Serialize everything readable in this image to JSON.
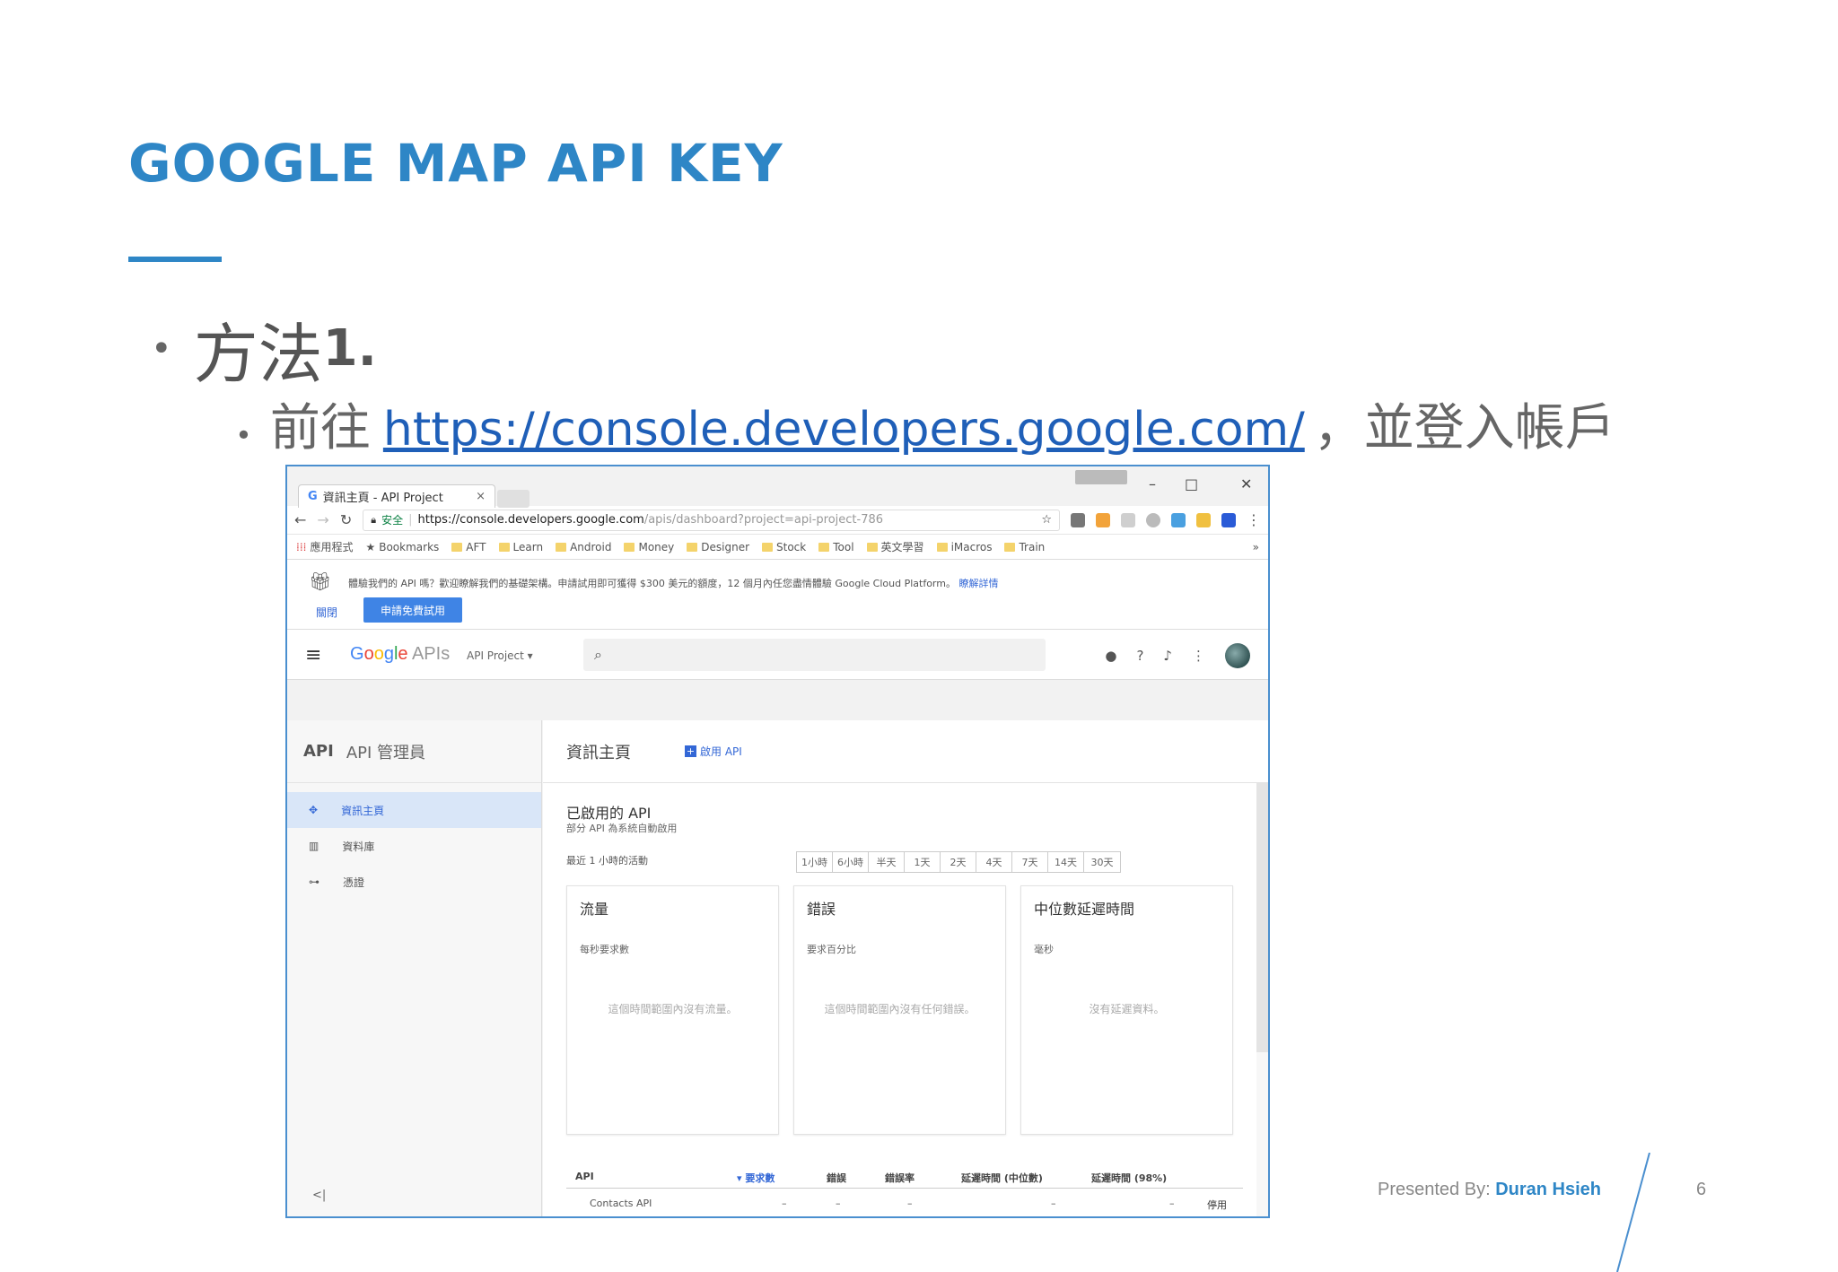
{
  "slide": {
    "title": "GOOGLE MAP API KEY",
    "bullet1_text": "方法",
    "bullet1_num": "1.",
    "bullet2_prefix": "前往",
    "bullet2_link": "https://console.developers.google.com/",
    "bullet2_suffix": "，並登入帳戶",
    "presented_by_label": "Presented By: ",
    "presenter": "Duran Hsieh",
    "page_number": "6"
  },
  "browser": {
    "tab_title": "資訊主頁 - API Project",
    "tab_favicon": "G",
    "tab_close": "×",
    "window_controls": [
      "–",
      "□",
      "✕"
    ],
    "secure_label": "安全",
    "url_main": "https://console.developers.google.com",
    "url_rest": "/apis/dashboard?project=api-project-786",
    "bookmarks": [
      "應用程式",
      "Bookmarks",
      "AFT",
      "Learn",
      "Android",
      "Money",
      "Designer",
      "Stock",
      "Tool",
      "英文學習",
      "iMacros",
      "Train"
    ],
    "bookmarks_more": "»",
    "extension_colors": [
      "#777777",
      "#f2a33a",
      "#cfcfcf",
      "#bbbbbb",
      "#4aa0e0",
      "#f0c040",
      "#2a5bd7"
    ]
  },
  "promo": {
    "text": "體驗我們的 API 嗎？歡迎瞭解我們的基礎架構。申請試用即可獲得 $300 美元的額度，12 個月內任您盡情體驗 Google Cloud Platform。",
    "learn_more": "瞭解詳情",
    "dismiss": "關閉",
    "try_button": "申請免費試用"
  },
  "appbar": {
    "logo_letters": [
      "G",
      "o",
      "o",
      "g",
      "l",
      "e"
    ],
    "logo_suffix": " APIs",
    "project": "API Project ▾",
    "search_icon": "⌕"
  },
  "sidebar": {
    "api_label": "API",
    "title": "API 管理員",
    "items": [
      {
        "icon": "✥",
        "label": "資訊主頁"
      },
      {
        "icon": "▥",
        "label": "資料庫"
      },
      {
        "icon": "⊶",
        "label": "憑證"
      }
    ],
    "collapse": "<|"
  },
  "main": {
    "title": "資訊主頁",
    "enable_api": "啟用 API",
    "section_title": "已啟用的 API",
    "section_subtitle": "部分 API 為系統自動啟用",
    "recent_label": "最近 1 小時的活動",
    "time_ranges": [
      "1小時",
      "6小時",
      "半天",
      "1天",
      "2天",
      "4天",
      "7天",
      "14天",
      "30天"
    ],
    "cards": [
      {
        "title": "流量",
        "subtitle": "每秒要求數",
        "empty": "這個時間範圍內沒有流量。"
      },
      {
        "title": "錯誤",
        "subtitle": "要求百分比",
        "empty": "這個時間範圍內沒有任何錯誤。"
      },
      {
        "title": "中位數延遲時間",
        "subtitle": "毫秒",
        "empty": "沒有延遲資料。"
      }
    ],
    "table_headers": [
      "API",
      "▾ 要求數",
      "錯誤",
      "錯誤率",
      "延遲時間 (中位數)",
      "延遲時間 (98%)"
    ],
    "table_row": {
      "api": "Contacts API",
      "requests": "–",
      "errors": "–",
      "error_rate": "–",
      "latency_median": "–",
      "latency_98": "–",
      "action": "停用"
    }
  }
}
